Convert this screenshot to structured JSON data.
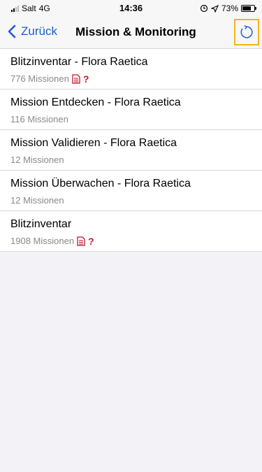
{
  "status_bar": {
    "carrier": "Salt",
    "network": "4G",
    "time": "14:36",
    "battery_percent": "73%",
    "battery_level": 0.73
  },
  "nav": {
    "back_label": "Zurück",
    "title": "Mission & Monitoring",
    "refresh_icon": "refresh-icon"
  },
  "items": [
    {
      "title": "Blitzinventar - Flora Raetica",
      "subtitle": "776 Missionen",
      "has_doc_flag": true
    },
    {
      "title": "Mission Entdecken - Flora Raetica",
      "subtitle": "116 Missionen",
      "has_doc_flag": false
    },
    {
      "title": "Mission Validieren -  Flora Raetica",
      "subtitle": "12 Missionen",
      "has_doc_flag": false
    },
    {
      "title": "Mission Überwachen - Flora Raetica",
      "subtitle": "12 Missionen",
      "has_doc_flag": false
    },
    {
      "title": "Blitzinventar",
      "subtitle": "1908 Missionen",
      "has_doc_flag": true
    }
  ],
  "flag_mark": "?",
  "colors": {
    "accent": "#1e5bd6",
    "highlight": "#f5b51a",
    "flag": "#c0172d"
  }
}
